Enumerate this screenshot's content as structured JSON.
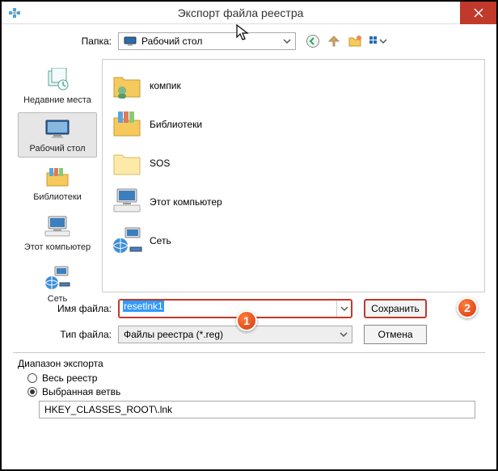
{
  "titlebar": {
    "title": "Экспорт файла реестра"
  },
  "folder_row": {
    "label": "Папка:",
    "selected_folder": "Рабочий стол"
  },
  "places": [
    {
      "label": "Недавние места",
      "icon": "recent"
    },
    {
      "label": "Рабочий стол",
      "icon": "desktop",
      "selected": true
    },
    {
      "label": "Библиотеки",
      "icon": "libraries"
    },
    {
      "label": "Этот компьютер",
      "icon": "computer"
    },
    {
      "label": "Сеть",
      "icon": "network"
    }
  ],
  "file_list": [
    {
      "label": "компик",
      "icon": "folder-user"
    },
    {
      "label": "Библиотеки",
      "icon": "libraries"
    },
    {
      "label": "SOS",
      "icon": "folder"
    },
    {
      "label": "Этот компьютер",
      "icon": "computer"
    },
    {
      "label": "Сеть",
      "icon": "network"
    }
  ],
  "filename": {
    "label": "Имя файла:",
    "value": "resetlnk1"
  },
  "filetype": {
    "label": "Тип файла:",
    "value": "Файлы реестра (*.reg)"
  },
  "buttons": {
    "save": "Сохранить",
    "cancel": "Отмена"
  },
  "export_range": {
    "title": "Диапазон экспорта",
    "all": "Весь реестр",
    "branch": "Выбранная ветвь",
    "branch_value": "HKEY_CLASSES_ROOT\\.lnk"
  },
  "badges": {
    "one": "1",
    "two": "2"
  }
}
